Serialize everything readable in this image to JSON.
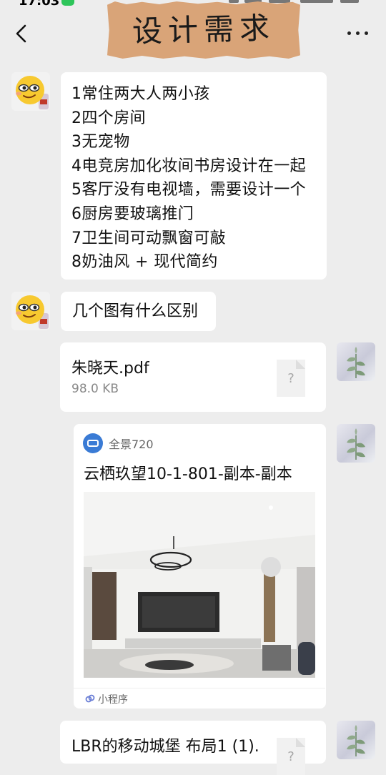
{
  "status_bar": {
    "time": "17:03"
  },
  "header": {
    "title": "设计需求"
  },
  "messages": [
    {
      "type": "text",
      "sender": "other",
      "lines": [
        "1常住两大人两小孩",
        "2四个房间",
        "3无宠物",
        "4电竞房加化妆间书房设计在一起",
        "5客厅没有电视墙，需要设计一个",
        "6厨房要玻璃推门",
        "7卫生间可动飘窗可敲",
        "8奶油风 + 现代简约"
      ]
    },
    {
      "type": "text",
      "sender": "other",
      "text": "几个图有什么区别"
    },
    {
      "type": "file",
      "sender": "self",
      "file_name": "朱晓天.pdf",
      "file_size": "98.0 KB",
      "icon_glyph": "?"
    },
    {
      "type": "mini_program",
      "sender": "self",
      "app_name": "全景720",
      "title": "云栖玖望10-1-801-副本-副本",
      "footer": "小程序",
      "footer_icon": "mini-program-icon"
    },
    {
      "type": "file",
      "sender": "self",
      "file_name": "LBR的移动城堡 布局1 (1).",
      "icon_glyph": "?"
    }
  ],
  "colors": {
    "background": "#ededed",
    "bubble": "#ffffff",
    "tape": "#d9a478",
    "mini_logo": "#3a7bd5"
  }
}
